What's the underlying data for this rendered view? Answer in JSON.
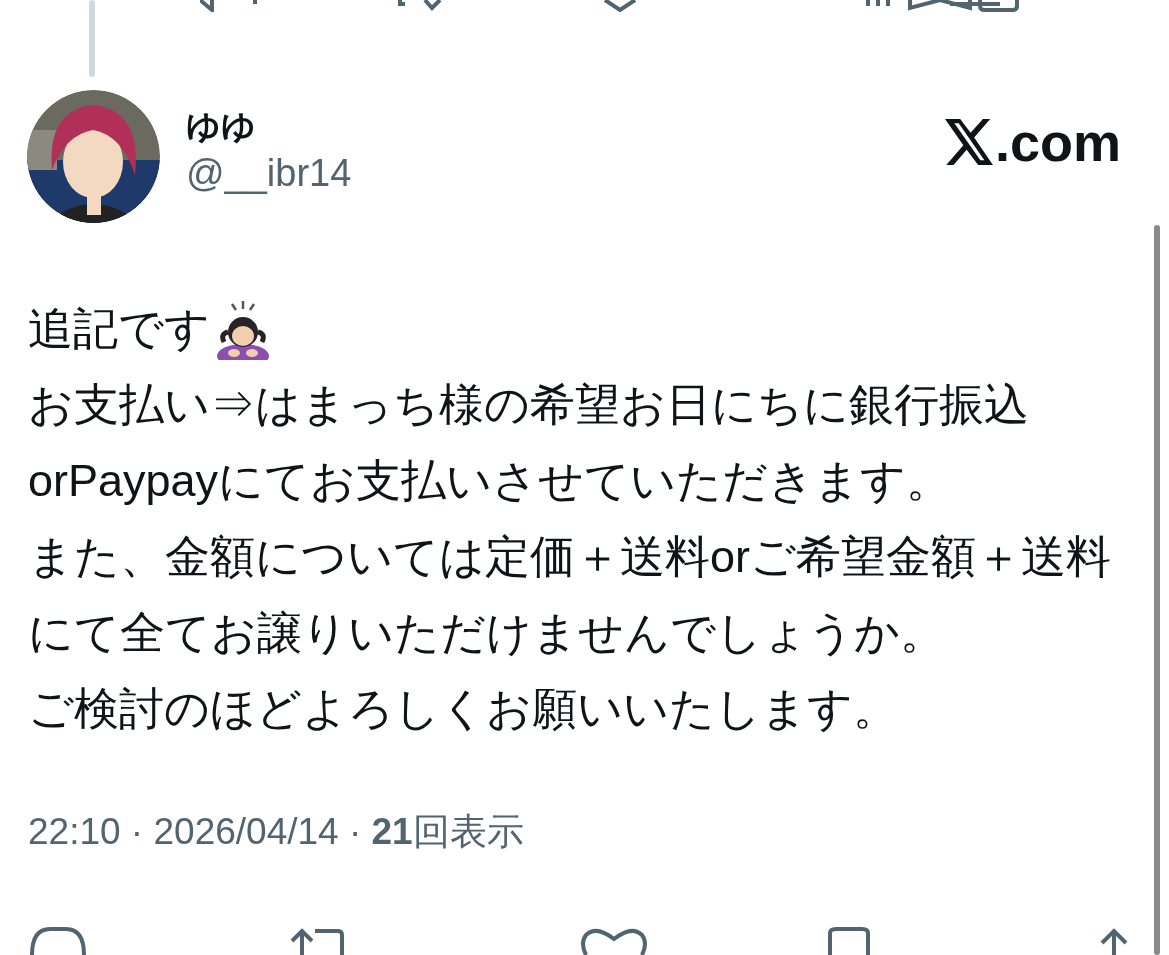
{
  "post": {
    "author": {
      "name": "ゆゆ",
      "handle": "@__ibr14"
    },
    "source": ".com",
    "paragraphs": [
      "追記です",
      "お支払い⇒はまっち様の希望お日にちに銀行振込orPaypayにてお支払いさせていただきます。",
      "また、金額については定価＋送料orご希望金額＋送料にて全てお譲りいただけませんでしょうか。",
      "ご検討のほどよろしくお願いいたします。"
    ],
    "meta": "22:10 · 2026/04/14 · **21**回表示"
  }
}
